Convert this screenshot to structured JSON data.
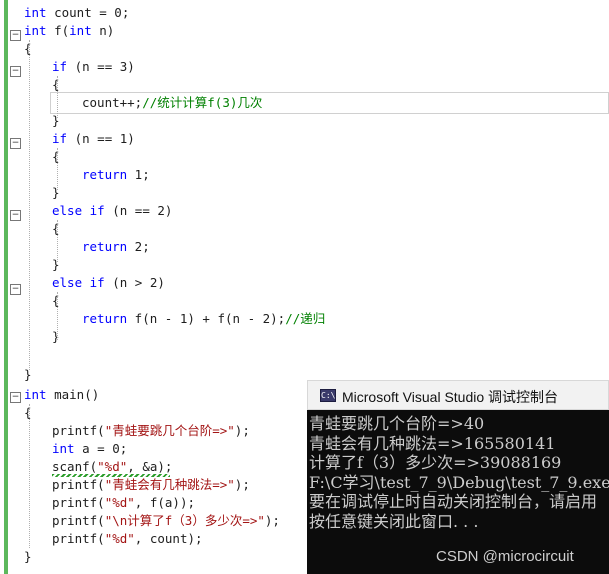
{
  "editor": {
    "lines": [
      {
        "parts": [
          {
            "t": "int",
            "c": "kw"
          },
          {
            "t": " count = 0;",
            "c": "txt"
          }
        ]
      },
      {
        "parts": [
          {
            "t": "int",
            "c": "kw"
          },
          {
            "t": " f(",
            "c": "txt"
          },
          {
            "t": "int",
            "c": "kw"
          },
          {
            "t": " n)",
            "c": "txt"
          }
        ]
      },
      {
        "parts": [
          {
            "t": "{",
            "c": "txt"
          }
        ]
      },
      {
        "parts": [
          {
            "t": "if",
            "c": "kw"
          },
          {
            "t": " (n == 3)",
            "c": "txt"
          }
        ]
      },
      {
        "parts": [
          {
            "t": "{",
            "c": "txt"
          }
        ]
      },
      {
        "parts": [
          {
            "t": "count++;",
            "c": "txt"
          },
          {
            "t": "//统计计算f(3)几次",
            "c": "cm"
          }
        ]
      },
      {
        "parts": [
          {
            "t": "}",
            "c": "txt"
          }
        ]
      },
      {
        "parts": [
          {
            "t": "if",
            "c": "kw"
          },
          {
            "t": " (n == 1)",
            "c": "txt"
          }
        ]
      },
      {
        "parts": [
          {
            "t": "{",
            "c": "txt"
          }
        ]
      },
      {
        "parts": [
          {
            "t": "return",
            "c": "kw"
          },
          {
            "t": " 1;",
            "c": "txt"
          }
        ]
      },
      {
        "parts": [
          {
            "t": "}",
            "c": "txt"
          }
        ]
      },
      {
        "parts": [
          {
            "t": "else",
            "c": "kw"
          },
          {
            "t": " ",
            "c": "txt"
          },
          {
            "t": "if",
            "c": "kw"
          },
          {
            "t": " (n == 2)",
            "c": "txt"
          }
        ]
      },
      {
        "parts": [
          {
            "t": "{",
            "c": "txt"
          }
        ]
      },
      {
        "parts": [
          {
            "t": "return",
            "c": "kw"
          },
          {
            "t": " 2;",
            "c": "txt"
          }
        ]
      },
      {
        "parts": [
          {
            "t": "}",
            "c": "txt"
          }
        ]
      },
      {
        "parts": [
          {
            "t": "else",
            "c": "kw"
          },
          {
            "t": " ",
            "c": "txt"
          },
          {
            "t": "if",
            "c": "kw"
          },
          {
            "t": " (n > 2)",
            "c": "txt"
          }
        ]
      },
      {
        "parts": [
          {
            "t": "{",
            "c": "txt"
          }
        ]
      },
      {
        "parts": [
          {
            "t": "return",
            "c": "kw"
          },
          {
            "t": " f(n - 1) + f(n - 2);",
            "c": "txt"
          },
          {
            "t": "//递归",
            "c": "cm"
          }
        ]
      },
      {
        "parts": [
          {
            "t": "}",
            "c": "txt"
          }
        ]
      },
      {
        "parts": []
      },
      {
        "parts": []
      },
      {
        "parts": [
          {
            "t": "}",
            "c": "txt"
          }
        ]
      },
      {
        "parts": [
          {
            "t": "int",
            "c": "kw"
          },
          {
            "t": " main()",
            "c": "txt"
          }
        ]
      },
      {
        "parts": [
          {
            "t": "{",
            "c": "txt"
          }
        ]
      },
      {
        "parts": [
          {
            "t": "printf(",
            "c": "txt"
          },
          {
            "t": "\"青蛙要跳几个台阶=>\"",
            "c": "str"
          },
          {
            "t": ");",
            "c": "txt"
          }
        ]
      },
      {
        "parts": [
          {
            "t": "int",
            "c": "kw"
          },
          {
            "t": " a = 0;",
            "c": "txt"
          }
        ]
      },
      {
        "parts": [
          {
            "t": "scanf(",
            "c": "txt"
          },
          {
            "t": "\"%d\"",
            "c": "str"
          },
          {
            "t": ", &a);",
            "c": "txt"
          }
        ]
      },
      {
        "parts": [
          {
            "t": "printf(",
            "c": "txt"
          },
          {
            "t": "\"青蛙会有几种跳法=>\"",
            "c": "str"
          },
          {
            "t": ");",
            "c": "txt"
          }
        ]
      },
      {
        "parts": [
          {
            "t": "printf(",
            "c": "txt"
          },
          {
            "t": "\"%d\"",
            "c": "str"
          },
          {
            "t": ", f(a));",
            "c": "txt"
          }
        ]
      },
      {
        "parts": [
          {
            "t": "printf(",
            "c": "txt"
          },
          {
            "t": "\"\\n计算了f（3）多少次=>\"",
            "c": "str"
          },
          {
            "t": ");",
            "c": "txt"
          }
        ]
      },
      {
        "parts": [
          {
            "t": "printf(",
            "c": "txt"
          },
          {
            "t": "\"%d\"",
            "c": "str"
          },
          {
            "t": ", count);",
            "c": "txt"
          }
        ]
      },
      {
        "parts": [
          {
            "t": "}",
            "c": "txt"
          }
        ]
      }
    ],
    "fold_glyph": "−"
  },
  "console": {
    "title": "Microsoft Visual Studio 调试控制台",
    "icon_text": "C:\\",
    "icon": "console-app-icon",
    "lines": [
      "青蛙要跳几个台阶=>40",
      "青蛙会有几种跳法=>165580141",
      "计算了f（3）多少次=>39088169",
      "F:\\C学习\\test_7_9\\Debug\\test_7_9.exe",
      "要在调试停止时自动关闭控制台，请启用",
      "按任意键关闭此窗口. . ."
    ]
  },
  "watermark": "CSDN @microcircuit",
  "colors": {
    "keyword": "#0000ff",
    "string": "#a31515",
    "comment": "#008000",
    "console_bg": "#0c0c0c",
    "console_text": "#cccccc",
    "change_bar": "#5cb85c"
  }
}
